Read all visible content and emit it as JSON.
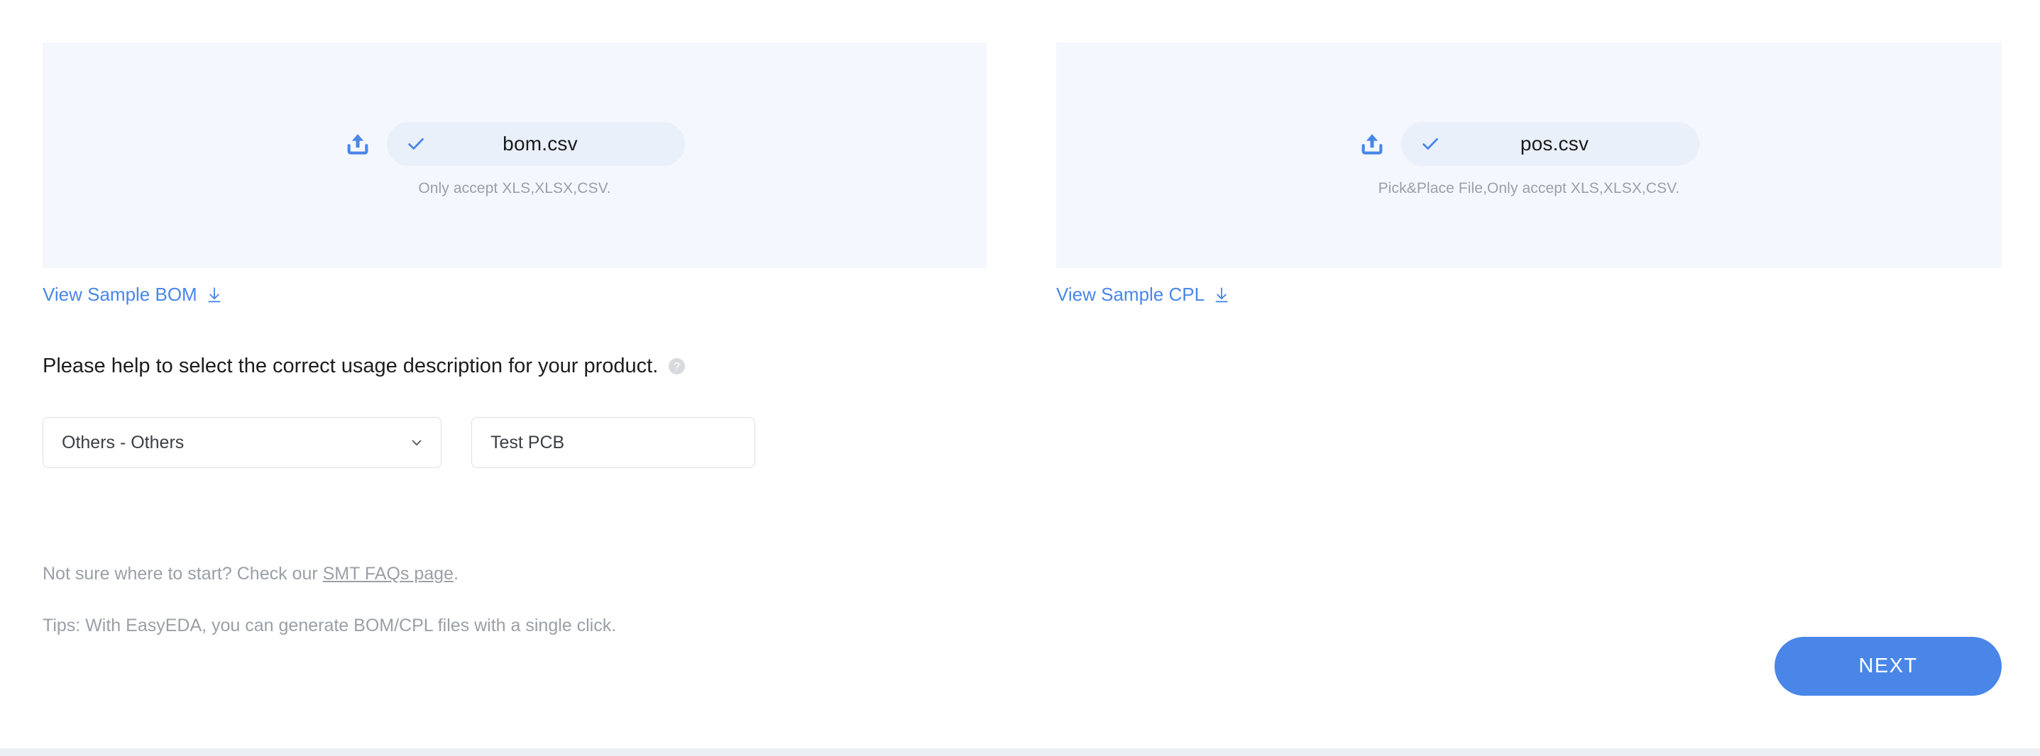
{
  "uploads": [
    {
      "id": "bom",
      "upload_icon": "upload-icon",
      "check_icon": "check-icon",
      "file_name": "bom.csv",
      "accept_note": "Only accept XLS,XLSX,CSV.",
      "sample_link_label": "View Sample BOM",
      "sample_link_icon": "download-icon"
    },
    {
      "id": "cpl",
      "upload_icon": "upload-icon",
      "check_icon": "check-icon",
      "file_name": "pos.csv",
      "accept_note": "Pick&Place File,Only accept XLS,XLSX,CSV.",
      "sample_link_label": "View Sample CPL",
      "sample_link_icon": "download-icon"
    }
  ],
  "usage": {
    "heading": "Please help to select the correct usage description for your product.",
    "help_icon": "question-mark-circle-icon",
    "select": {
      "value": "Others - Others",
      "chevron_icon": "chevron-down-icon"
    },
    "input": {
      "value": "Test PCB",
      "placeholder": ""
    }
  },
  "notes": {
    "faq_prefix": "Not sure where to start? Check our ",
    "faq_link": "SMT FAQs page",
    "faq_suffix": ".",
    "tips": "Tips: With EasyEDA, you can generate BOM/CPL files with a single click."
  },
  "actions": {
    "next_label": "NEXT"
  },
  "colors": {
    "panel_bg": "#f4f7fd",
    "chip_bg": "#e9f0fa",
    "accent_blue": "#4a86e8",
    "muted_text": "#9b9fa6",
    "border": "#dcdfe4",
    "bottom_band": "#eceff4"
  }
}
